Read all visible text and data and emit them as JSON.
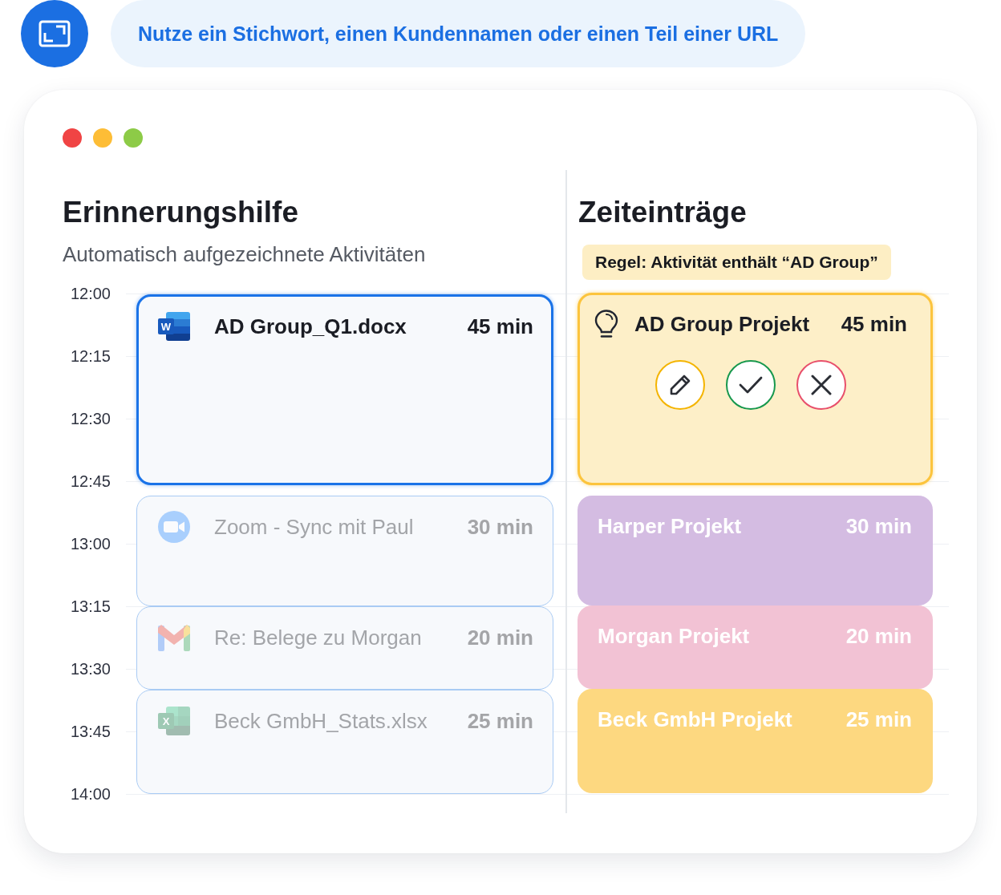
{
  "banner": {
    "text": "Nutze ein Stichwort, einen Kundennamen oder einen Teil einer URL"
  },
  "window": {
    "controls": [
      {
        "color": "#f04444"
      },
      {
        "color": "#fdbd36"
      },
      {
        "color": "#8dcb47"
      }
    ]
  },
  "reminder_panel": {
    "title": "Erinnerungshilfe",
    "subtitle": "Automatisch aufgezeichnete Aktivitäten",
    "times": [
      "12:00",
      "12:15",
      "12:30",
      "12:45",
      "13:00",
      "13:15",
      "13:30",
      "13:45",
      "14:00"
    ],
    "activities": [
      {
        "kind": "document",
        "badge": "W",
        "title": "AD Group_Q1.docx",
        "duration": "45 min",
        "selected": true
      },
      {
        "kind": "meeting",
        "title": "Zoom - Sync mit Paul",
        "duration": "30 min",
        "selected": false
      },
      {
        "kind": "email",
        "title": "Re: Belege zu Morgan",
        "duration": "20 min",
        "selected": false
      },
      {
        "kind": "spreadsheet",
        "badge": "X",
        "title": "Beck GmbH_Stats.xlsx",
        "duration": "25 min",
        "selected": false
      }
    ]
  },
  "time_entries_panel": {
    "title": "Zeiteinträge",
    "rule": "Regel: Aktivität enthält “AD Group”",
    "entries": [
      {
        "kind": "suggestion",
        "title": "AD Group Projekt",
        "duration": "45 min",
        "color": "#fdefc8",
        "actions": [
          {
            "kind": "edit"
          },
          {
            "kind": "accept"
          },
          {
            "kind": "reject"
          }
        ]
      },
      {
        "kind": "entry",
        "title": "Harper Projekt",
        "duration": "30 min",
        "color": "#d4bce2"
      },
      {
        "kind": "entry",
        "title": "Morgan Projekt",
        "duration": "20 min",
        "color": "#f2c2d4"
      },
      {
        "kind": "entry",
        "title": "Beck GmbH Projekt",
        "duration": "25 min",
        "color": "#fdd880"
      }
    ]
  }
}
